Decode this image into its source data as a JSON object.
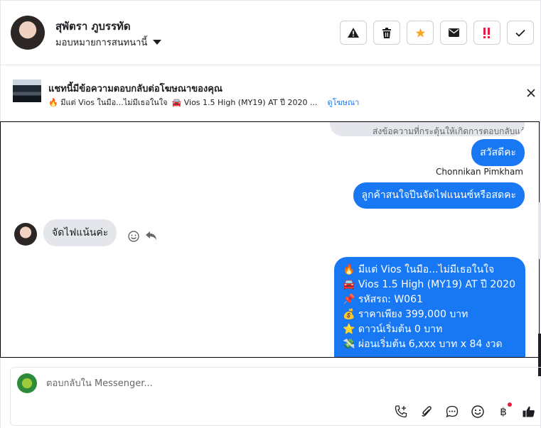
{
  "header": {
    "contact_name": "สุพัตรา ภูบรรทัด",
    "assign_label": "มอบหมายการสนทนานี้",
    "actions": [
      {
        "name": "report-button",
        "icon": "warning-icon",
        "glyph": "⚠"
      },
      {
        "name": "delete-button",
        "icon": "trash-icon",
        "glyph": "🗑"
      },
      {
        "name": "star-button",
        "icon": "star-icon",
        "glyph": "★"
      },
      {
        "name": "mark-unread-button",
        "icon": "envelope-icon",
        "glyph": "✉"
      },
      {
        "name": "spam-button",
        "icon": "spam-icon",
        "glyph": "‼"
      },
      {
        "name": "done-button",
        "icon": "checkmark-icon",
        "glyph": "✓"
      }
    ]
  },
  "ad_bar": {
    "title": "แชทนี้มีข้อความตอบกลับต่อโฆษณาของคุณ",
    "snippet_1": "🔥 มีแต่ Vios ในมือ...ไม่มีเธอในใจ",
    "snippet_2": "🚘 Vios 1.5 High (MY19) AT ปี 2020 ...",
    "link": "ดูโฆษณา"
  },
  "thread": {
    "cut_text": "ส่งข้อความที่กระตุ้นให้เกิดการตอบกลับแล้ว",
    "msg_hello": "สวัสดีคะ",
    "sender_name": "Chonnikan Pimkham",
    "msg_question": "ลูกค้าสนใจปีนจัดไฟแนนซ์หรือสดคะ",
    "msg_incoming": "จัดไฟแน้นค่ะ",
    "ad_message": [
      "🔥 มีแต่ Vios ในมือ...ไม่มีเธอในใจ",
      "🚘 Vios 1.5 High (MY19) AT ปี 2020",
      "📌 รหัสรถ: W061",
      "💰 ราคาเพียง 399,000 บาท",
      "⭐ ดาวน์เริ่มต้น 0 บาท",
      "💸 ผ่อนเริ่มต้น 6,xxx บาท x 84 งวด"
    ]
  },
  "composer": {
    "placeholder": "ตอบกลับใน Messenger..."
  },
  "colors": {
    "accent": "#1877f2",
    "bubble_in": "#e4e6eb",
    "star": "#f5a623",
    "spam": "#e41e3f"
  }
}
